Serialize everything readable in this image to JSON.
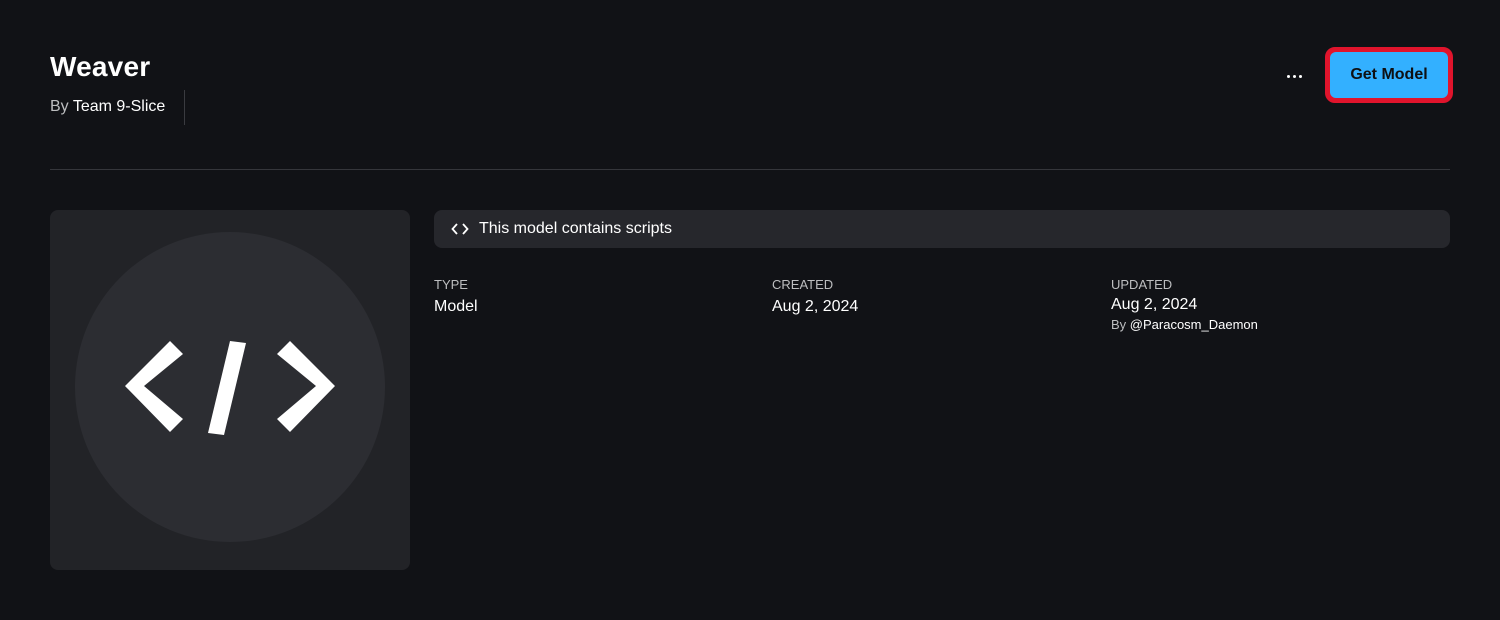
{
  "header": {
    "title": "Weaver",
    "by_prefix": "By",
    "creator": "Team 9-Slice",
    "more_icon": "ellipsis-icon",
    "get_button_label": "Get Model"
  },
  "thumbnail": {
    "icon": "code-brackets-icon"
  },
  "scripts_banner": {
    "icon": "code-icon",
    "text": "This model contains scripts"
  },
  "details": {
    "type": {
      "label": "TYPE",
      "value": "Model"
    },
    "created": {
      "label": "CREATED",
      "value": "Aug 2, 2024"
    },
    "updated": {
      "label": "UPDATED",
      "value": "Aug 2, 2024",
      "by_prefix": "By",
      "user": "@Paracosm_Daemon"
    }
  },
  "colors": {
    "background": "#111216",
    "accent_button": "#33b0ff",
    "highlight_border": "#e0142c",
    "panel": "#222327",
    "banner": "#26272c"
  }
}
